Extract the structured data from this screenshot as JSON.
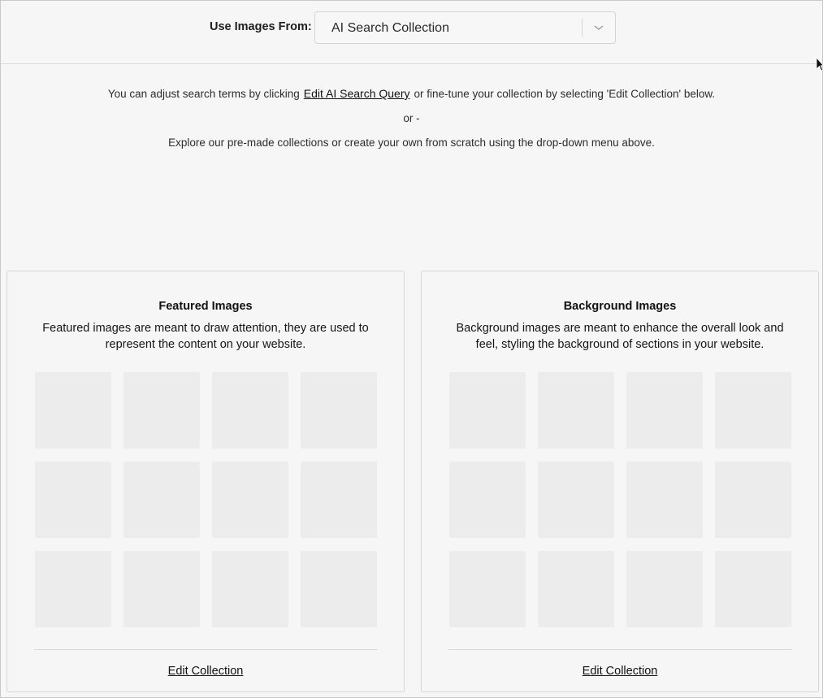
{
  "header": {
    "source_label": "Use Images From:",
    "source_select": {
      "value": "AI Search Collection",
      "chevron_icon": "chevron-down-icon"
    }
  },
  "info": {
    "line1_before": "You can adjust search terms by clicking",
    "line1_link": "Edit AI Search Query",
    "line1_after": "or fine-tune your collection by selecting 'Edit Collection' below.",
    "divider": "or -",
    "line3": "Explore our pre-made collections or create your own from scratch using the drop-down menu above."
  },
  "panels": [
    {
      "title": "Featured Images",
      "description": "Featured images are meant to draw attention, they are used to represent the content on your website.",
      "link": "Edit Collection"
    },
    {
      "title": "Background Images",
      "description": "Background images are meant to enhance the overall look and feel, styling the background of sections in your website.",
      "link": "Edit Collection"
    }
  ],
  "colors": {
    "background": "#f6f6f6",
    "placeholder_tile": "#ececec",
    "border": "#d6d6d6",
    "text": "#1e1e1e"
  }
}
